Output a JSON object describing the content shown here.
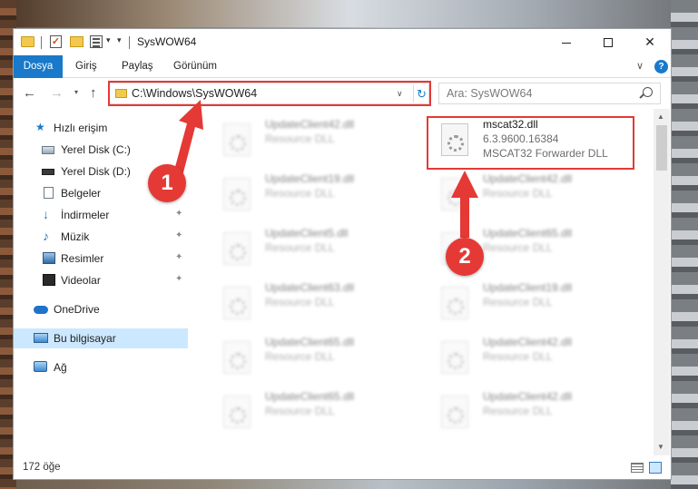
{
  "window": {
    "title": "SysWOW64",
    "minimize_icon": "minimize-icon",
    "maximize_icon": "maximize-icon",
    "close_glyph": "✕"
  },
  "ribbon": {
    "tabs": [
      {
        "label": "Dosya",
        "active": true
      },
      {
        "label": "Giriş"
      },
      {
        "label": "Paylaş"
      },
      {
        "label": "Görünüm"
      }
    ],
    "collapse_glyph": "∨",
    "help_glyph": "?"
  },
  "navigation": {
    "back_glyph": "←",
    "forward_glyph": "→",
    "recent_glyph": "▾",
    "up_glyph": "↑"
  },
  "address": {
    "path": "C:\\Windows\\SysWOW64",
    "dropdown_glyph": "∨",
    "refresh_glyph": "↻"
  },
  "search": {
    "placeholder": "Ara: SysWOW64"
  },
  "sidebar": {
    "items": [
      {
        "label": "Hızlı erişim",
        "icon": "star-icon"
      },
      {
        "label": "Yerel Disk (C:)",
        "icon": "disk-icon"
      },
      {
        "label": "Yerel Disk (D:)",
        "icon": "disk-icon"
      },
      {
        "label": "Belgeler",
        "icon": "document-icon",
        "pinned": true
      },
      {
        "label": "İndirmeler",
        "icon": "download-icon",
        "pinned": true
      },
      {
        "label": "Müzik",
        "icon": "music-icon",
        "pinned": true
      },
      {
        "label": "Resimler",
        "icon": "pictures-icon",
        "pinned": true
      },
      {
        "label": "Videolar",
        "icon": "video-icon",
        "pinned": true
      },
      {
        "label": "OneDrive",
        "icon": "onedrive-icon"
      },
      {
        "label": "Bu bilgisayar",
        "icon": "computer-icon",
        "selected": true
      },
      {
        "label": "Ağ",
        "icon": "network-icon"
      }
    ],
    "pin_glyph": "📌"
  },
  "files": {
    "left": [
      {
        "name": "UpdateClient42.dll",
        "desc": "Resource DLL"
      },
      {
        "name": "UpdateClient19.dll",
        "desc": "Resource DLL"
      },
      {
        "name": "UpdateClient5.dll",
        "desc": "Resource DLL"
      },
      {
        "name": "UpdateClient63.dll",
        "desc": "Resource DLL"
      },
      {
        "name": "UpdateClient65.dll",
        "desc": "Resource DLL"
      },
      {
        "name": "UpdateClient65.dll",
        "desc": "Resource DLL"
      }
    ],
    "right": [
      {
        "name": "mscat32.dll",
        "desc": "6.3.9600.16384",
        "desc2": "MSCAT32 Forwarder DLL",
        "highlighted": true
      },
      {
        "name": "UpdateClient42.dll",
        "desc": "Resource DLL"
      },
      {
        "name": "UpdateClient65.dll",
        "desc": "Resource DLL"
      },
      {
        "name": "UpdateClient19.dll",
        "desc": "Resource DLL"
      },
      {
        "name": "UpdateClient42.dll",
        "desc": "Resource DLL"
      },
      {
        "name": "UpdateClient42.dll",
        "desc": "Resource DLL"
      }
    ]
  },
  "status": {
    "item_count": "172 öğe"
  },
  "annotations": {
    "step1": "1",
    "step2": "2",
    "color": "#e53935"
  },
  "colors": {
    "accent": "#1979ca",
    "selection": "#cce8ff",
    "highlight": "#e53935"
  }
}
